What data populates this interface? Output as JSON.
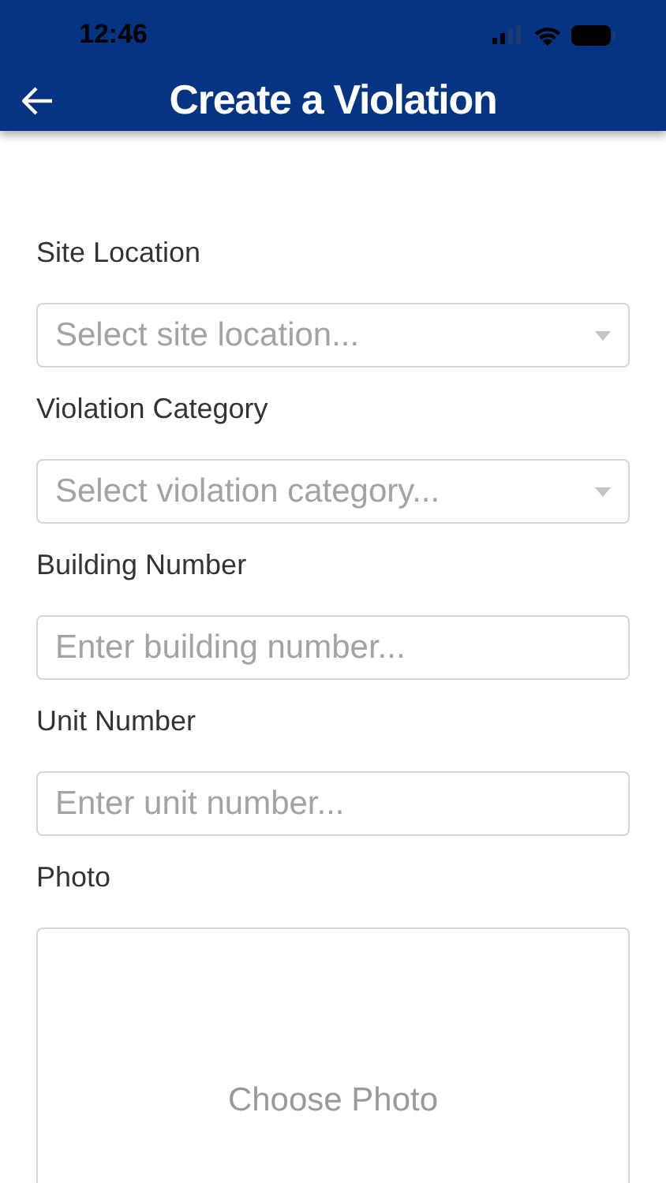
{
  "status_bar": {
    "time": "12:46"
  },
  "header": {
    "title": "Create a Violation"
  },
  "fields": [
    {
      "kind": "select",
      "label": "Site Location",
      "placeholder": "Select site location..."
    },
    {
      "kind": "select",
      "label": "Violation Category",
      "placeholder": "Select violation category..."
    },
    {
      "kind": "text",
      "label": "Building Number",
      "placeholder": "Enter building number..."
    },
    {
      "kind": "text",
      "label": "Unit Number",
      "placeholder": "Enter unit number..."
    }
  ],
  "photo": {
    "label": "Photo",
    "button": "Choose Photo"
  }
}
